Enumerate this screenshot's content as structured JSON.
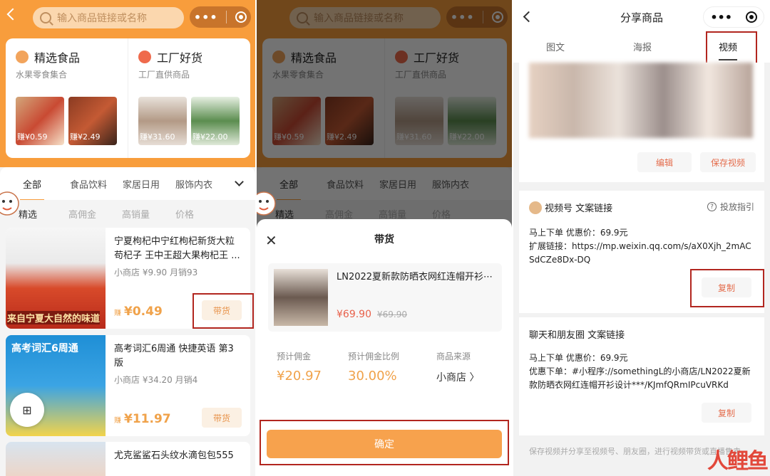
{
  "shared": {
    "search_placeholder": "输入商品链接或名称",
    "menu_dots": "•••"
  },
  "categories": [
    {
      "title": "精选食品",
      "subtitle": "水果零食集合",
      "prices": [
        "赚¥0.59",
        "赚¥2.49"
      ],
      "icon": "fruit-icon",
      "color": "#f2a45c"
    },
    {
      "title": "工厂好货",
      "subtitle": "工厂直供商品",
      "prices": [
        "赚¥31.60",
        "赚¥22.00"
      ],
      "icon": "factory-icon",
      "color": "#ef6a4c"
    }
  ],
  "tabs": [
    "全部",
    "食品饮料",
    "家居日用",
    "服饰内衣"
  ],
  "subtabs": [
    "精选",
    "高佣金",
    "高销量",
    "价格"
  ],
  "items": [
    {
      "name": "宁夏枸杞中宁红枸杞新货大粒苟杞子 王中王超大果枸杞王 ...",
      "meta": "小商店 ¥9.90  月销93",
      "earn_prefix": "赚",
      "price": "¥0.49",
      "button": "带货",
      "img_text": "来自宁夏大自然的味道"
    },
    {
      "name": "高考词汇6周通 快捷英语 第3版",
      "meta": "小商店 ¥34.20  月销4",
      "earn_prefix": "赚",
      "price": "¥11.97",
      "button": "带货",
      "img_text": "高考词汇6周通"
    },
    {
      "name": "尤克鲨鲨石头纹水滴包包555",
      "meta": "",
      "earn_prefix": "",
      "price": "",
      "button": "",
      "img_text": ""
    }
  ],
  "sheet": {
    "title": "带货",
    "close": "✕",
    "product_name": "LN2022夏新款防晒衣网红连帽开衫⋯",
    "product_price": "¥69.90",
    "product_old_price": "¥69.90",
    "stats": [
      {
        "label": "预计佣金",
        "value": "¥20.97"
      },
      {
        "label": "预计佣金比例",
        "value": "30.00%"
      },
      {
        "label": "商品来源",
        "value": "小商店 〉"
      }
    ],
    "confirm": "确定"
  },
  "share": {
    "title": "分享商品",
    "tabs": [
      "图文",
      "海报",
      "视频"
    ],
    "edit": "编辑",
    "save_video": "保存视频",
    "card1_title": "视频号 文案链接",
    "guide": "投放指引",
    "card1_text": "马上下单 优惠价：69.9元\n扩展链接：https://mp.weixin.qq.com/s/aX0Xjh_2mACSdCZe8Dx-DQ",
    "copy": "复制",
    "card2_title": "聊天和朋友圈 文案链接",
    "card2_text": "马上下单 优惠价：69.9元\n优惠下单：#小程序://somethingL的小商店/LN2022夏新款防晒衣网红连帽开衫设计***/KJmfQRmIPcuVRKd",
    "footer": "保存视频并分享至视频号、朋友圈，进行视频带货或直播售卖",
    "logo": "人鲤鱼"
  }
}
